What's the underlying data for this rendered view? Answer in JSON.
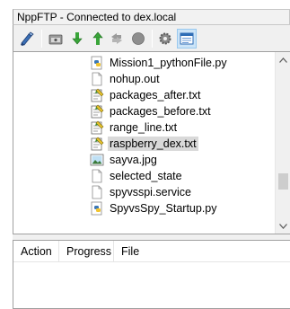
{
  "window": {
    "title": "NppFTP - Connected to dex.local"
  },
  "toolbar": {
    "buttons": [
      {
        "icon": "connect-icon"
      },
      {
        "icon": "open-folder-icon"
      },
      {
        "icon": "download-icon"
      },
      {
        "icon": "upload-icon"
      },
      {
        "icon": "refresh-icon"
      },
      {
        "icon": "abort-icon"
      },
      {
        "icon": "settings-icon"
      },
      {
        "icon": "message-window-icon"
      }
    ]
  },
  "files": [
    {
      "name": "Mission1_pythonFile.py",
      "icon": "python-file-icon",
      "selected": false
    },
    {
      "name": "nohup.out",
      "icon": "blank-file-icon",
      "selected": false
    },
    {
      "name": "packages_after.txt",
      "icon": "text-file-icon",
      "selected": false
    },
    {
      "name": "packages_before.txt",
      "icon": "text-file-icon",
      "selected": false
    },
    {
      "name": "range_line.txt",
      "icon": "text-file-icon",
      "selected": false
    },
    {
      "name": "raspberry_dex.txt",
      "icon": "text-file-icon",
      "selected": true
    },
    {
      "name": "sayva.jpg",
      "icon": "image-file-icon",
      "selected": false
    },
    {
      "name": "selected_state",
      "icon": "blank-file-icon",
      "selected": false
    },
    {
      "name": "spyvsspi.service",
      "icon": "blank-file-icon",
      "selected": false
    },
    {
      "name": "SpyvsSpy_Startup.py",
      "icon": "python-file-icon",
      "selected": false
    }
  ],
  "queue": {
    "columns": [
      "Action",
      "Progress",
      "File"
    ]
  },
  "colors": {
    "selection": "#d9d9d9",
    "active_button": "#cce4f7"
  }
}
